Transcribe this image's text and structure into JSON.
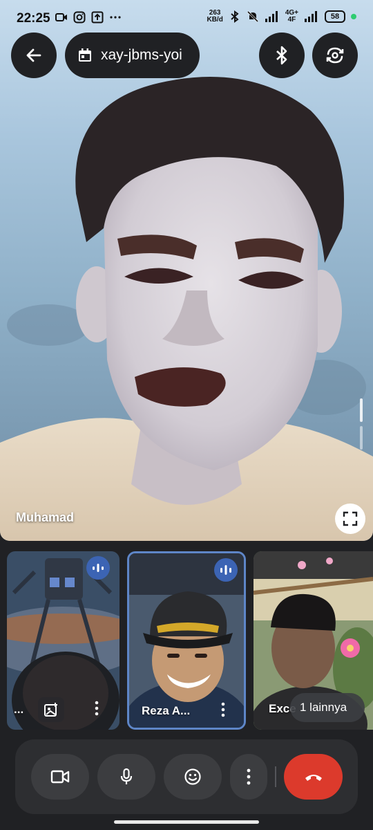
{
  "status_bar": {
    "time": "22:25",
    "net_speed_value": "263",
    "net_speed_unit": "KB/d",
    "network_label_top": "4G+",
    "network_label_bottom": "4F",
    "battery": "58",
    "icons": [
      "video-icon",
      "instagram-icon",
      "upload-icon",
      "more-dots-icon",
      "bluetooth-icon",
      "bell-muted-icon",
      "signal-icon",
      "signal-icon",
      "battery-icon"
    ]
  },
  "header": {
    "meeting_code": "xay-jbms-yoi",
    "icons": [
      "back-arrow-icon",
      "calendar-icon",
      "bluetooth-icon",
      "switch-camera-icon"
    ]
  },
  "main_video": {
    "participant_name": "Muhamad",
    "icons": [
      "fullscreen-icon"
    ]
  },
  "participants": [
    {
      "name": "...",
      "speaking": true
    },
    {
      "name": "Reza A...",
      "speaking": true,
      "active": true
    },
    {
      "name": "Exce",
      "others_label": "1 lainnya"
    }
  ],
  "controls": {
    "icons": [
      "camera-icon",
      "microphone-icon",
      "emoji-icon",
      "more-vert-icon",
      "end-call-icon"
    ],
    "colors": {
      "end_call": "#dc3a2c",
      "speaking_badge": "#3c64b4",
      "active_border": "#5e86c8"
    }
  }
}
